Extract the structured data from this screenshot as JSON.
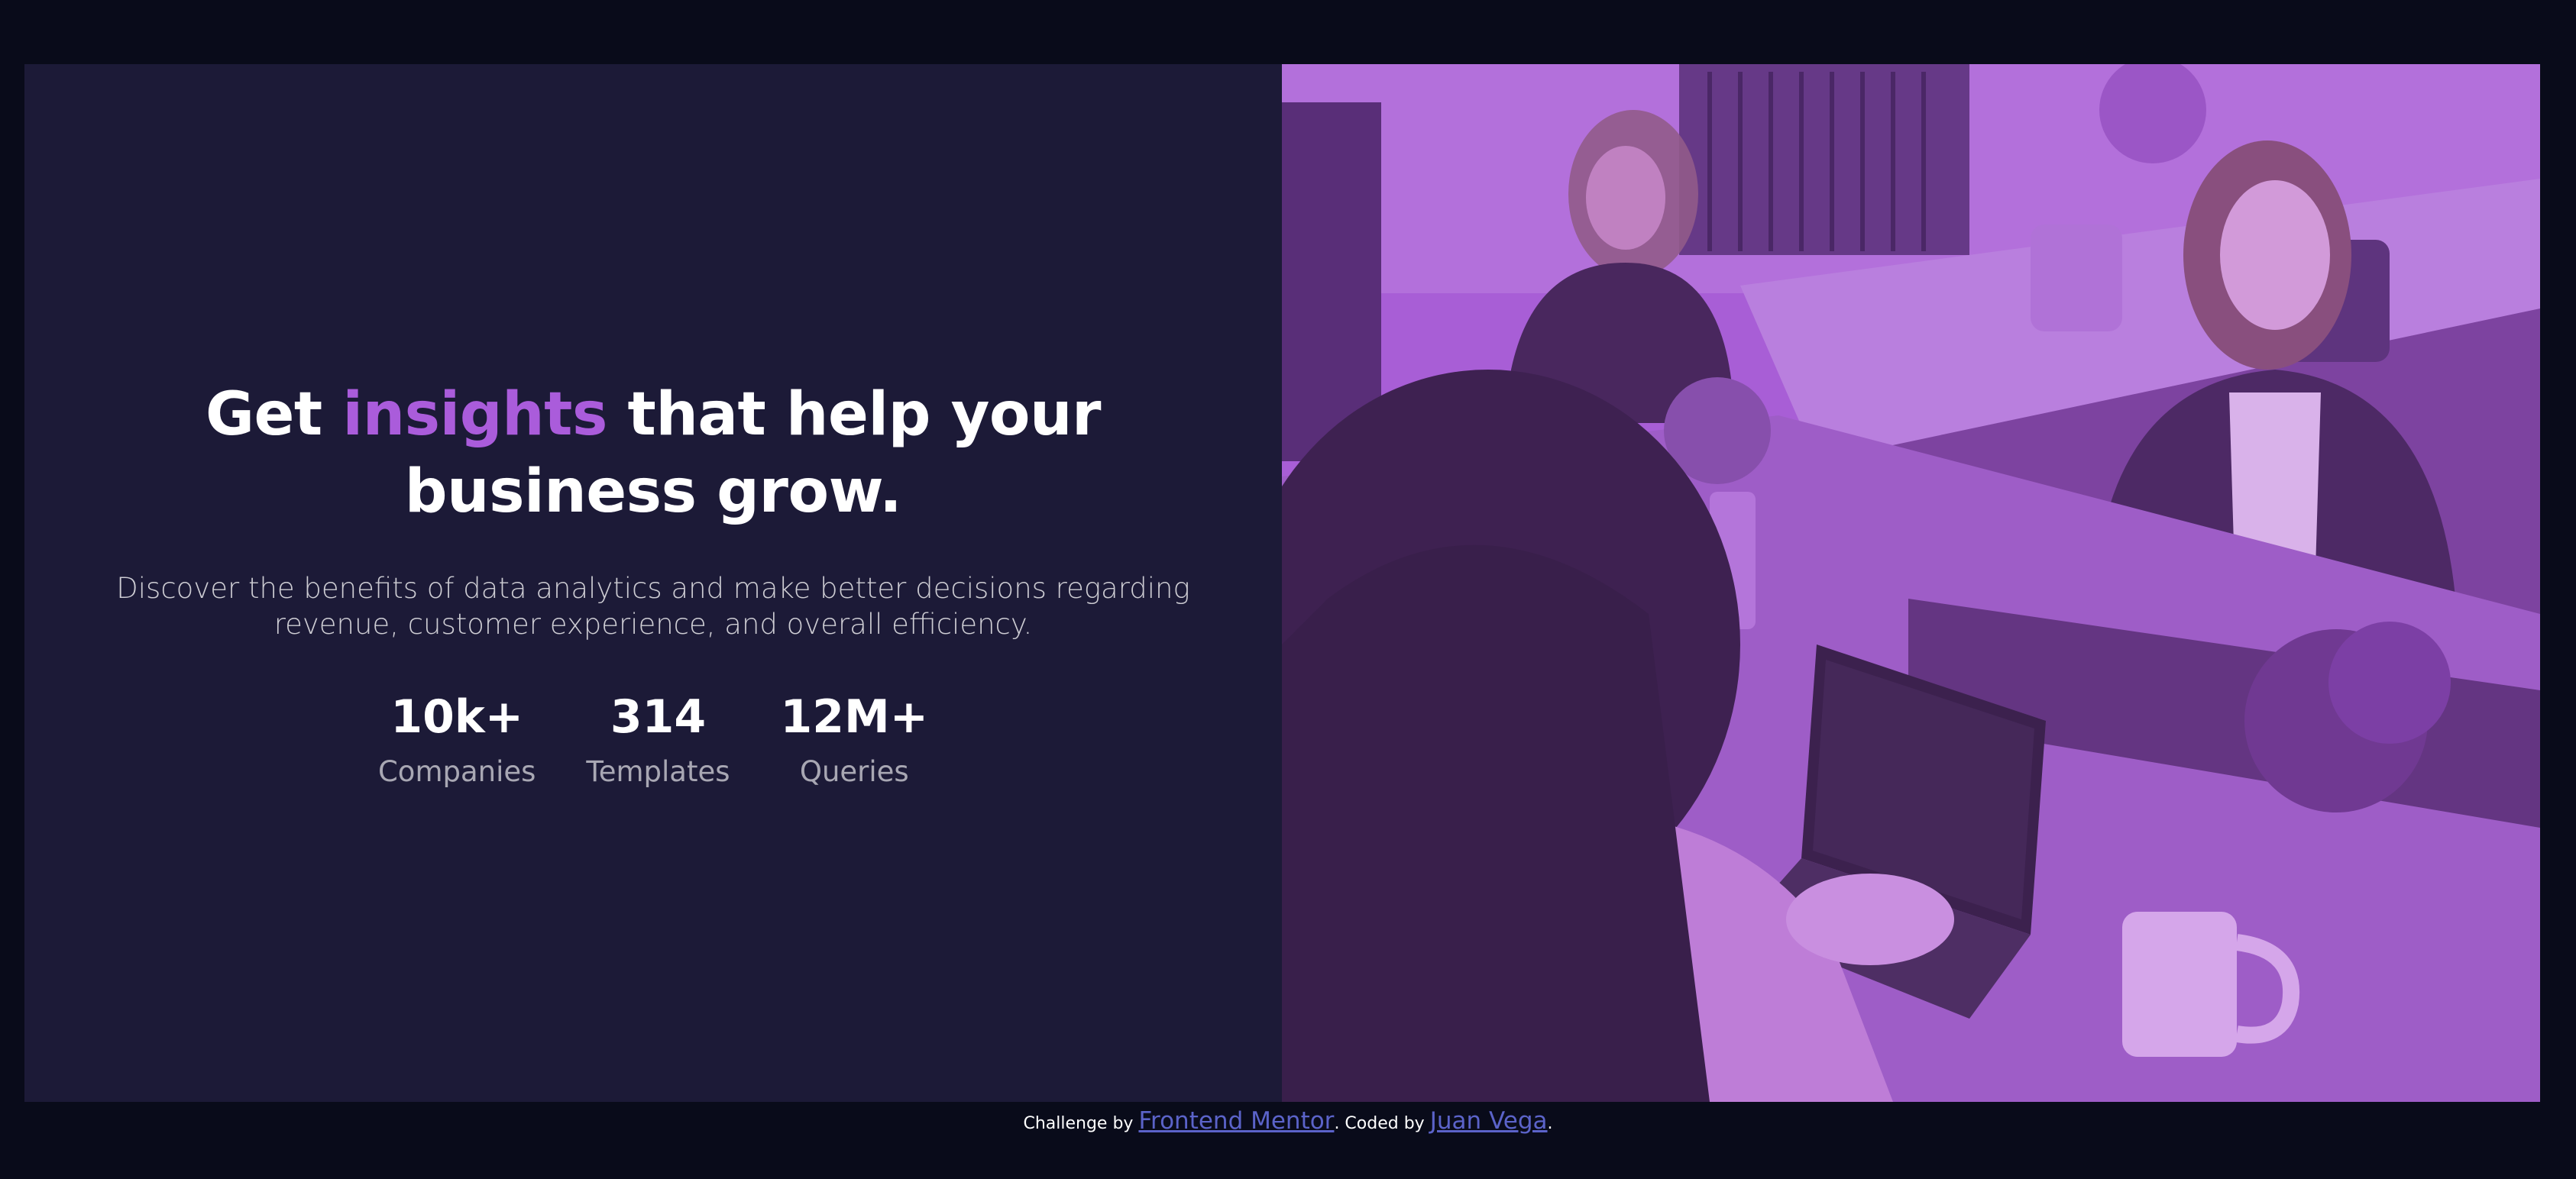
{
  "hero": {
    "headline_part1": "Get ",
    "headline_accent": "insights",
    "headline_part2": " that help your business grow.",
    "subtext": "Discover the benefits of data analytics and make better decisions regarding revenue, customer experience, and overall efficiency."
  },
  "stats": [
    {
      "value": "10k+",
      "label": "Companies"
    },
    {
      "value": "314",
      "label": "Templates"
    },
    {
      "value": "12M+",
      "label": "Queries"
    }
  ],
  "footer": {
    "prefix": "Challenge by ",
    "link1": "Frontend Mentor",
    "middle": ". Coded by ",
    "link2": "Juan Vega",
    "suffix": "."
  },
  "colors": {
    "page_bg": "#090b1a",
    "card_bg": "#1c1a37",
    "accent": "#aa5cdb",
    "photo_tint": "#a35ad0",
    "link": "#5b63c9"
  }
}
